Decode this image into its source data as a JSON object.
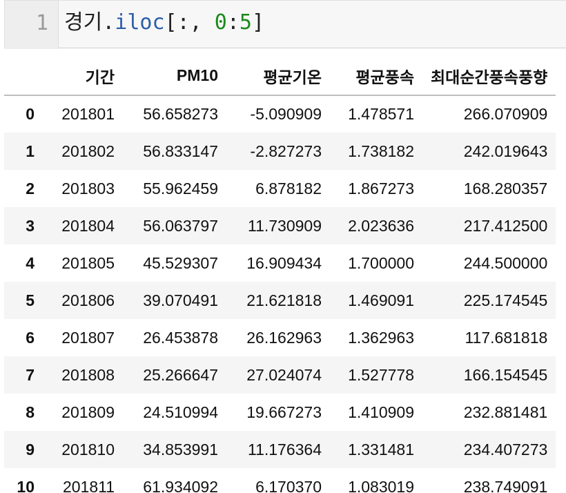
{
  "code_cell": {
    "line_number": "1",
    "tokens": {
      "object": "경기",
      "dot": ".",
      "attr": "iloc",
      "open": "[:, ",
      "start": "0",
      "colon": ":",
      "end": "5",
      "close": "]"
    }
  },
  "table": {
    "columns": [
      "기간",
      "PM10",
      "평균기온",
      "평균풍속",
      "최대순간풍속풍향"
    ],
    "rows": [
      {
        "index": "0",
        "cells": [
          "201801",
          "56.658273",
          "-5.090909",
          "1.478571",
          "266.070909"
        ]
      },
      {
        "index": "1",
        "cells": [
          "201802",
          "56.833147",
          "-2.827273",
          "1.738182",
          "242.019643"
        ]
      },
      {
        "index": "2",
        "cells": [
          "201803",
          "55.962459",
          "6.878182",
          "1.867273",
          "168.280357"
        ]
      },
      {
        "index": "3",
        "cells": [
          "201804",
          "56.063797",
          "11.730909",
          "2.023636",
          "217.412500"
        ]
      },
      {
        "index": "4",
        "cells": [
          "201805",
          "45.529307",
          "16.909434",
          "1.700000",
          "244.500000"
        ]
      },
      {
        "index": "5",
        "cells": [
          "201806",
          "39.070491",
          "21.621818",
          "1.469091",
          "225.174545"
        ]
      },
      {
        "index": "6",
        "cells": [
          "201807",
          "26.453878",
          "26.162963",
          "1.362963",
          "117.681818"
        ]
      },
      {
        "index": "7",
        "cells": [
          "201808",
          "25.266647",
          "27.024074",
          "1.527778",
          "166.154545"
        ]
      },
      {
        "index": "8",
        "cells": [
          "201809",
          "24.510994",
          "19.667273",
          "1.410909",
          "232.881481"
        ]
      },
      {
        "index": "9",
        "cells": [
          "201810",
          "34.853991",
          "11.176364",
          "1.331481",
          "234.407273"
        ]
      },
      {
        "index": "10",
        "cells": [
          "201811",
          "61.934092",
          "6.170370",
          "1.083019",
          "238.749091"
        ]
      }
    ]
  }
}
